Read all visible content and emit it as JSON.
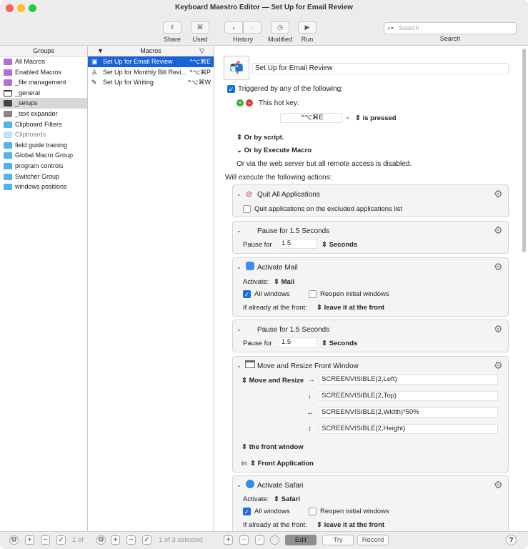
{
  "window": {
    "title": "Keyboard Maestro Editor — Set Up for Email Review"
  },
  "colors": {
    "close": "#fe5f57",
    "minimize": "#febc2e",
    "zoom": "#28c840",
    "selection": "#1a62d9",
    "folder": "#52b3f0",
    "smartgroup": "#b46fd6"
  },
  "toolbar": {
    "share": "Share",
    "used": "Used",
    "history": "History",
    "modified": "Modified",
    "run": "Run",
    "search_placeholder": "Search",
    "search_label": "Search",
    "used_glyph": "⌘",
    "run_glyph": "▶"
  },
  "groups": {
    "header": "Groups",
    "items": [
      {
        "label": "All Macros",
        "icon": "smart-group-icon"
      },
      {
        "label": "Enabled Macros",
        "icon": "smart-group-icon"
      },
      {
        "label": "_file management",
        "icon": "smart-group-icon"
      },
      {
        "label": "_general",
        "icon": "window-group-icon"
      },
      {
        "label": "_setups",
        "icon": "setups-group-icon"
      },
      {
        "label": "_text expander",
        "icon": "text-expander-group-icon"
      },
      {
        "label": "Clipboard Filters",
        "icon": "folder-icon"
      },
      {
        "label": "Clipboards",
        "icon": "folder-icon"
      },
      {
        "label": "field guide training",
        "icon": "folder-icon"
      },
      {
        "label": "Global Macro Group",
        "icon": "folder-icon"
      },
      {
        "label": "program controls",
        "icon": "folder-icon"
      },
      {
        "label": "Switcher Group",
        "icon": "folder-icon"
      },
      {
        "label": "windows positions",
        "icon": "folder-icon"
      }
    ]
  },
  "macros": {
    "header": "Macros",
    "items": [
      {
        "label": "Set Up for Email Review",
        "key": "^⌥⌘E"
      },
      {
        "label": "Set Up for Monthly Bill Revi...",
        "key": "^⌥⌘P"
      },
      {
        "label": "Set Up for Writing",
        "key": "^⌥⌘W"
      }
    ]
  },
  "editor": {
    "macro_name": "Set Up for Email Review",
    "triggered_label": "Triggered by any of the following:",
    "hotkey_label": "This hot key:",
    "hotkey_value": "^⌥⌘E",
    "hotkey_state": "is pressed",
    "or_script": "Or by script.",
    "or_execute": "Or by Execute Macro",
    "web_note": "Or via the web server but all remote access is disabled.",
    "will_execute": "Will execute the following actions:",
    "actions": [
      {
        "title": "Quit All Applications",
        "option": "Quit applications on the excluded applications list"
      },
      {
        "title": "Pause for 1.5 Seconds",
        "pause_label": "Pause for",
        "value": "1.5",
        "unit": "Seconds"
      },
      {
        "title": "Activate Mail",
        "activate_label": "Activate:",
        "app": "Mail",
        "all_windows": "All windows",
        "reopen": "Reopen initial windows",
        "front_label": "If already at the front:",
        "front_value": "leave it at the front"
      },
      {
        "title": "Pause for 1.5 Seconds",
        "pause_label": "Pause for",
        "value": "1.5",
        "unit": "Seconds"
      },
      {
        "title": "Move and Resize Front Window",
        "mode": "Move and Resize",
        "left": "SCREENVISIBLE(2,Left)",
        "top": "SCREENVISIBLE(2,Top)",
        "width": "SCREENVISIBLE(2,Width)*50%",
        "height": "SCREENVISIBLE(2,Height)",
        "target": "the front window",
        "in_label": "in",
        "in_value": "Front Application"
      },
      {
        "title": "Activate Safari",
        "activate_label": "Activate:",
        "app": "Safari",
        "all_windows": "All windows",
        "reopen": "Reopen initial windows",
        "front_label": "If already at the front:",
        "front_value": "leave it at the front"
      }
    ]
  },
  "bottombar": {
    "groups_count": "1 of",
    "macros_count": "1 of 3 selected",
    "edit": "Edit",
    "try": "Try",
    "record": "Record",
    "help": "?"
  }
}
